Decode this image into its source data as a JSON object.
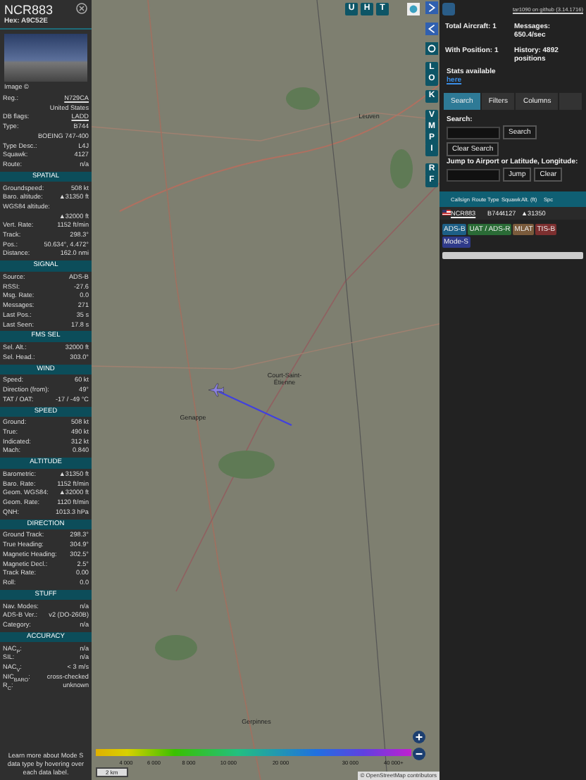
{
  "aircraft_panel": {
    "callsign": "NCR883",
    "hex": "Hex: A9C52E",
    "image_credit": "Image ©",
    "info_rows": [
      {
        "label": "Reg.:",
        "value": "N729CA",
        "kind": "link"
      },
      {
        "value": "United States",
        "kind": "plain"
      },
      {
        "label": "DB flags:",
        "value": "LADD",
        "kind": "link"
      },
      {
        "label": "Type:",
        "value": "B744",
        "kind": "plain"
      },
      {
        "value": "BOEING 747-400",
        "kind": "plain"
      },
      {
        "label": "Type Desc.:",
        "value": "L4J",
        "kind": "plain"
      },
      {
        "label": "Squawk:",
        "value": "4127",
        "kind": "plain"
      },
      {
        "label": "Route:",
        "value": "n/a",
        "kind": "plain"
      }
    ],
    "sections": [
      {
        "title": "SPATIAL",
        "rows": [
          {
            "label": "Groundspeed:",
            "value": "508 kt",
            "kind": "plain"
          },
          {
            "label": "Baro. altitude:",
            "value": "▲31350 ft",
            "kind": "plain"
          },
          {
            "label": "WGS84 altitude:",
            "value": "▲32000 ft",
            "kind": "stacked"
          },
          {
            "label": "Vert. Rate:",
            "value": "1152 ft/min",
            "kind": "plain"
          },
          {
            "label": "Track:",
            "value": "298.3°",
            "kind": "plain"
          },
          {
            "label": "Pos.:",
            "value": "50.634°, 4.472°",
            "kind": "plain"
          },
          {
            "label": "Distance:",
            "value": "162.0 nmi",
            "kind": "plain"
          }
        ]
      },
      {
        "title": "SIGNAL",
        "rows": [
          {
            "label": "Source:",
            "value": "ADS-B",
            "kind": "plain"
          },
          {
            "label": "RSSI:",
            "value": "-27.6",
            "kind": "plain"
          },
          {
            "label": "Msg. Rate:",
            "value": "0.0",
            "kind": "plain"
          },
          {
            "label": "Messages:",
            "value": "271",
            "kind": "plain"
          },
          {
            "label": "Last Pos.:",
            "value": "35 s",
            "kind": "plain"
          },
          {
            "label": "Last Seen:",
            "value": "17.8 s",
            "kind": "plain"
          }
        ]
      },
      {
        "title": "FMS SEL",
        "rows": [
          {
            "label": "Sel. Alt.:",
            "value": "32000 ft",
            "kind": "plain"
          },
          {
            "label": "Sel. Head.:",
            "value": "303.0°",
            "kind": "plain"
          }
        ]
      },
      {
        "title": "WIND",
        "rows": [
          {
            "label": "Speed:",
            "value": "60 kt",
            "kind": "plain"
          },
          {
            "label": "Direction (from):",
            "value": "49°",
            "kind": "plain"
          },
          {
            "label": "TAT / OAT:",
            "value": "-17 / -49 °C",
            "kind": "plain"
          }
        ]
      },
      {
        "title": "SPEED",
        "rows": [
          {
            "label": "Ground:",
            "value": "508 kt",
            "kind": "plain"
          },
          {
            "label": "True:",
            "value": "490 kt",
            "kind": "plain"
          },
          {
            "label": "Indicated:",
            "value": "312 kt",
            "kind": "plain"
          },
          {
            "label": "Mach:",
            "value": "0.840",
            "kind": "plain"
          }
        ]
      },
      {
        "title": "ALTITUDE",
        "rows": [
          {
            "label": "Barometric:",
            "value": "▲31350 ft",
            "kind": "plain"
          },
          {
            "label": "Baro. Rate:",
            "value": "1152 ft/min",
            "kind": "plain"
          },
          {
            "label": "Geom. WGS84:",
            "value": "▲32000 ft",
            "kind": "plain"
          },
          {
            "label": "Geom. Rate:",
            "value": "1120 ft/min",
            "kind": "plain"
          },
          {
            "label": "QNH:",
            "value": "1013.3 hPa",
            "kind": "plain"
          }
        ]
      },
      {
        "title": "DIRECTION",
        "rows": [
          {
            "label": "Ground Track:",
            "value": "298.3°",
            "kind": "plain"
          },
          {
            "label": "True Heading:",
            "value": "304.9°",
            "kind": "plain"
          },
          {
            "label": "Magnetic Heading:",
            "value": "302.5°",
            "kind": "plain"
          },
          {
            "label": "Magnetic Decl.:",
            "value": "2.5°",
            "kind": "plain"
          },
          {
            "label": "Track Rate:",
            "value": "0.00",
            "kind": "plain"
          },
          {
            "label": "Roll:",
            "value": "0.0",
            "kind": "plain"
          }
        ]
      },
      {
        "title": "STUFF",
        "rows": [
          {
            "label": "Nav. Modes:",
            "value": "n/a",
            "kind": "plain"
          },
          {
            "label": "ADS-B Ver.:",
            "value": "v2 (DO-260B)",
            "kind": "plain"
          },
          {
            "label": "Category:",
            "value": "n/a",
            "kind": "plain"
          }
        ]
      },
      {
        "title": "ACCURACY",
        "rows": [
          {
            "label": "NAC$_{P}$:",
            "value": "n/a",
            "kind": "plain"
          },
          {
            "label": "SIL:",
            "value": "n/a",
            "kind": "plain"
          },
          {
            "label": "NAC$_{V}$:",
            "value": "< 3 m/s",
            "kind": "plain"
          },
          {
            "label": "NIC$_{BARO}$:",
            "value": "cross-checked",
            "kind": "plain"
          },
          {
            "label": "R$_{C}$:",
            "value": "unknown",
            "kind": "plain"
          }
        ]
      }
    ],
    "footer": "Learn more about Mode S data type by hovering over each data label."
  },
  "map": {
    "place_labels": [
      "Leuven",
      "Court-Saint-Étienne",
      "Genappe",
      "Gerpinnes"
    ],
    "top_buttons": [
      "U",
      "H",
      "T"
    ],
    "side_buttons": [
      "L",
      "O",
      "K",
      "V",
      "M",
      "P",
      "I",
      "R",
      "F"
    ],
    "altitude_scale": [
      "4 000",
      "6 000",
      "8 000",
      "10 000",
      "20 000",
      "30 000",
      "40 000+"
    ],
    "scale_label": "2 km",
    "attribution": "© OpenStreetMap contributors"
  },
  "side_panel": {
    "version_link": "tar1090 on github (3.14.1716)",
    "stats": [
      {
        "label": "Total Aircraft: 1"
      },
      {
        "label": "Messages:",
        "value": "650.4/sec"
      },
      {
        "label": "With Position: 1"
      },
      {
        "label": "History: 4892",
        "value": "positions"
      }
    ],
    "stats_text": "Stats available",
    "stats_link": "here",
    "tabs": [
      {
        "label": "Search",
        "selected": true
      },
      {
        "label": "Filters",
        "selected": false
      },
      {
        "label": "Columns",
        "selected": false
      }
    ],
    "search_label": "Search:",
    "search_button": "Search",
    "clear_search_button": "Clear Search",
    "jump_label": "Jump to Airport or Latitude, Longitude:",
    "jump_button": "Jump",
    "clear_button": "Clear",
    "table": {
      "columns": [
        "Callsign",
        "Route",
        "Type",
        "Squawk",
        "Alt. (ft)",
        "Spc"
      ],
      "rows": [
        {
          "callsign": "NCR883",
          "route": "",
          "type": "B744",
          "squawk": "4127",
          "altitude": "▲31350"
        }
      ]
    },
    "legend": [
      {
        "label": "ADS-B",
        "color": "#1d5f86"
      },
      {
        "label": "UAT / ADS-R",
        "color": "#2a6b36"
      },
      {
        "label": "MLAT",
        "color": "#7a5b3c"
      },
      {
        "label": "TIS-B",
        "color": "#7c2f2f"
      },
      {
        "label": "Mode-S",
        "color": "#2f3a8a"
      }
    ]
  }
}
